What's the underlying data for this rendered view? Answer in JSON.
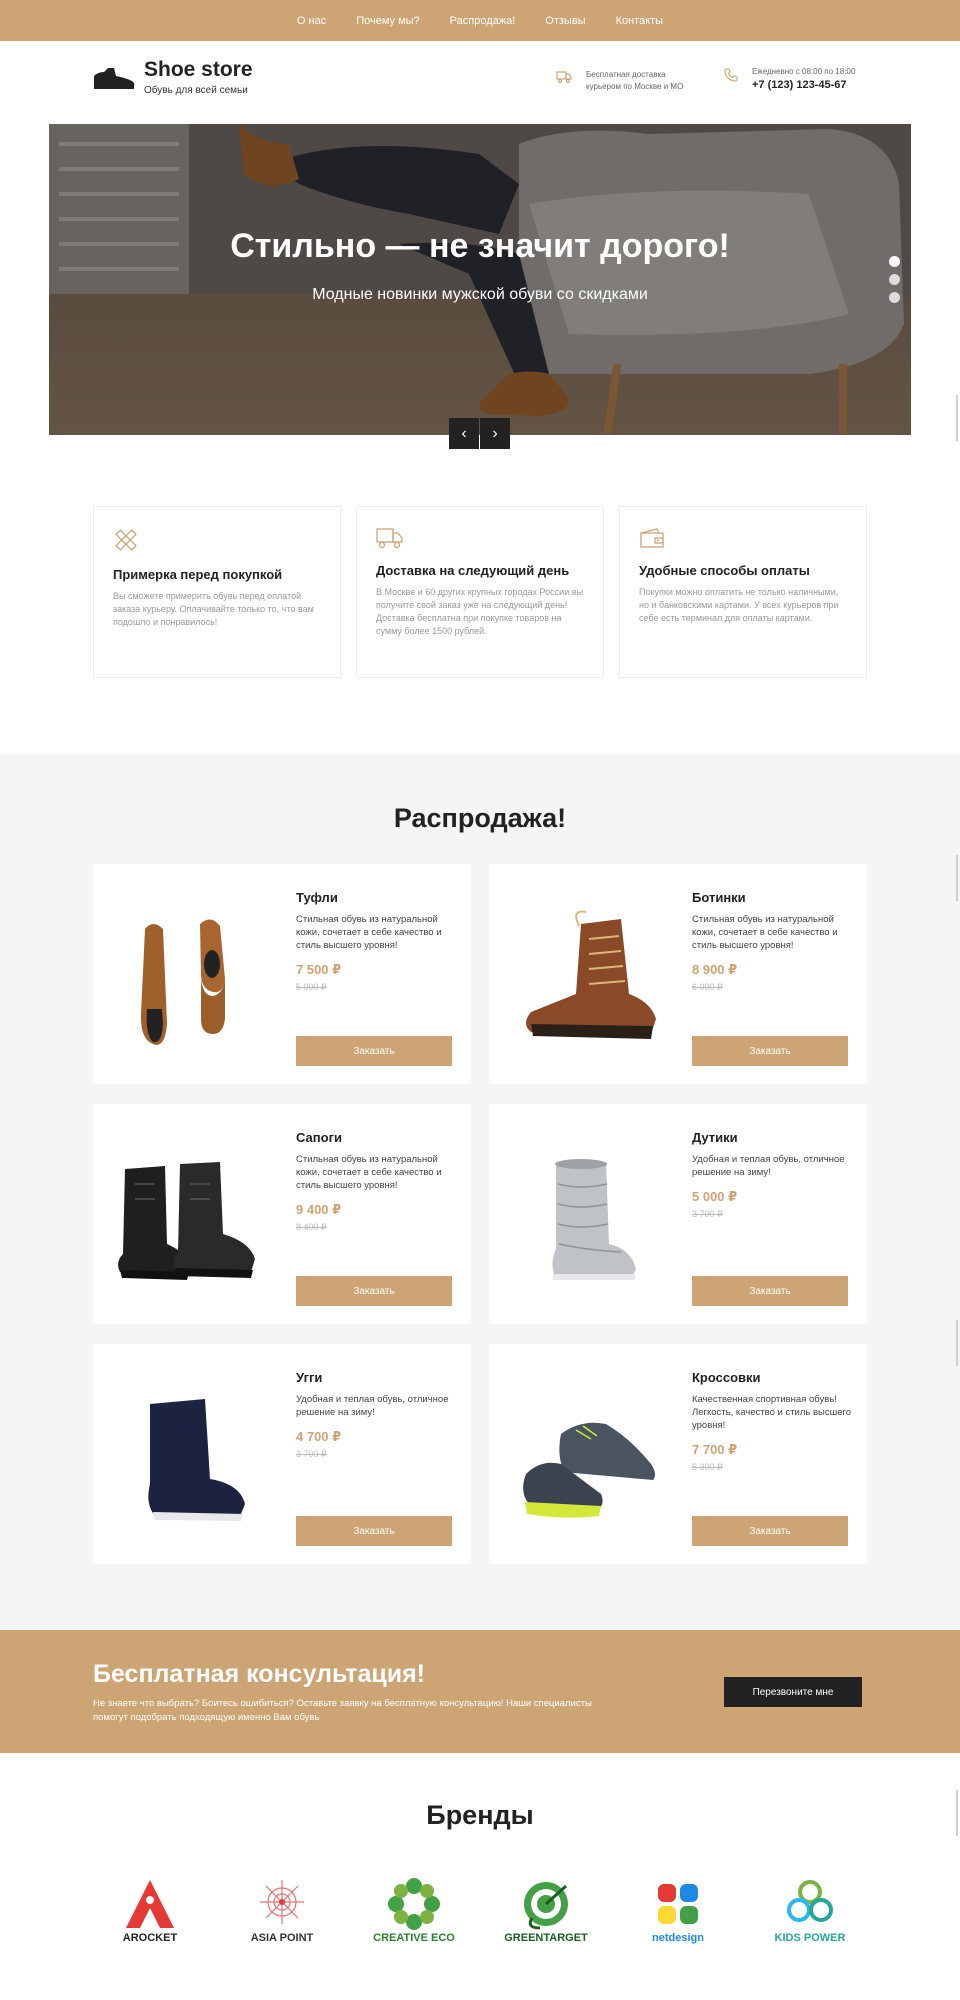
{
  "nav": {
    "items": [
      "О нас",
      "Почему мы?",
      "Распродажа!",
      "Отзывы",
      "Контакты"
    ]
  },
  "header": {
    "logo_title": "Shoe store",
    "logo_subtitle": "Обувь для всей семьи",
    "delivery_line1": "Бесплатная доставка",
    "delivery_line2": "курьером по Москве и МО",
    "hours": "Ежедневно с 08:00 по 18:00",
    "phone": "+7 (123) 123-45-67"
  },
  "hero": {
    "title": "Стильно — не значит дорого!",
    "subtitle": "Модные новинки мужской обуви со скидками",
    "prev_glyph": "‹",
    "next_glyph": "›",
    "active_slide": 1,
    "slides": 3
  },
  "features": [
    {
      "icon": "ruler-pencil-icon",
      "title": "Примерка перед покупкой",
      "text": "Вы сможете примерить обувь перед оплатой заказа курьеру. Оплачивайте только то, что вам подошло и понравилось!"
    },
    {
      "icon": "truck-icon",
      "title": "Доставка на следующий день",
      "text": "В Москве и 60 других крупных городах России вы получите свой заказ уже на следующий день! Доставка бесплатна при покупке товаров на сумму более 1500 рублей."
    },
    {
      "icon": "wallet-icon",
      "title": "Удобные способы оплаты",
      "text": "Покупки можно оплатить не только наличными, но и банковскими картами. У всех курьеров при себе есть терминал для оплаты картами."
    }
  ],
  "sale": {
    "title": "Распродажа!",
    "order_label": "Заказать",
    "products": [
      {
        "name": "Туфли",
        "desc": "Стильная обувь из натуральной кожи, сочетает в себе качество и стиль высшего уровня!",
        "price": "7 500 ₽",
        "old_price": "5 000 ₽",
        "image": "brown-oxford-shoes"
      },
      {
        "name": "Ботинки",
        "desc": "Стильная обувь из натуральной кожи, сочетает в себе качество и стиль высшего уровня!",
        "price": "8 900 ₽",
        "old_price": "6 000 ₽",
        "image": "brown-boot"
      },
      {
        "name": "Сапоги",
        "desc": "Стильная обувь из натуральной кожи, сочетает в себе качество и стиль высшего уровня!",
        "price": "9 400 ₽",
        "old_price": "8 400 ₽",
        "image": "black-boots"
      },
      {
        "name": "Дутики",
        "desc": "Удобная и теплая обувь, отличное решение на зиму!",
        "price": "5 000 ₽",
        "old_price": "3 700 ₽",
        "image": "silver-moon-boots"
      },
      {
        "name": "Угги",
        "desc": "Удобная и теплая обувь, отличное решение на зиму!",
        "price": "4 700 ₽",
        "old_price": "3 700 ₽",
        "image": "navy-ugg-boot"
      },
      {
        "name": "Кроссовки",
        "desc": "Качественная спортивная обувь! Легкость, качество и стиль высшего уровня!",
        "price": "7 700 ₽",
        "old_price": "5 300 ₽",
        "image": "grey-sneakers"
      }
    ]
  },
  "consult": {
    "title": "Бесплатная консультация!",
    "text": "Не знаете что выбрать? Боитесь ошибиться? Оставьте заявку на бесплатную консультацию! Наши специалисты помогут подобрать подходящую именно Вам обувь",
    "button": "Перезвоните мне"
  },
  "brands": {
    "title": "Бренды",
    "items": [
      {
        "name": "AROCKET",
        "color": "#e53935"
      },
      {
        "name": "ASIA POINT",
        "color": "#333333"
      },
      {
        "name": "CREATIVE ECO",
        "color": "#2e7d32"
      },
      {
        "name": "GREENTARGET",
        "color": "#1b5e20"
      },
      {
        "name": "netdesign",
        "color": "#1e88e5"
      },
      {
        "name": "KIDS POWER",
        "color": "#26a69a"
      }
    ]
  },
  "colors": {
    "accent": "#cda473",
    "dark": "#222222",
    "section_bg": "#f5f5f5"
  }
}
